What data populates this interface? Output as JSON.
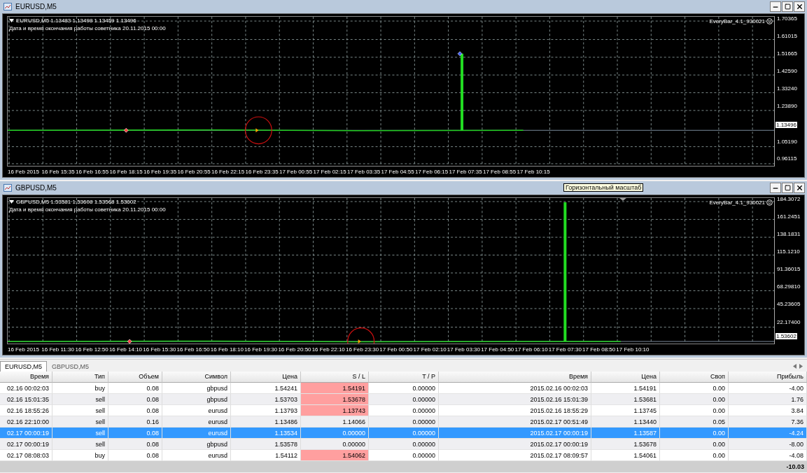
{
  "charts": [
    {
      "window_title": "EURUSD,M5",
      "info": "EURUSD,M5  1.13483 1.13498 1.13459 1.13496",
      "expert_note": "Дата и время окончания работы советника 20.11.2015 00:00",
      "expert_name": "EveryBar_4.1_930021",
      "price_labels": [
        "1.70365",
        "1.61015",
        "1.51665",
        "1.42590",
        "1.33240",
        "1.23890",
        "1.05190",
        "0.96115"
      ],
      "current_price": "1.13496",
      "time_labels": [
        "16 Feb 2015",
        "16 Feb 15:35",
        "16 Feb 16:55",
        "16 Feb 18:15",
        "16 Feb 19:35",
        "16 Feb 20:55",
        "16 Feb 22:15",
        "16 Feb 23:35",
        "17 Feb 00:55",
        "17 Feb 02:15",
        "17 Feb 03:35",
        "17 Feb 04:55",
        "17 Feb 06:15",
        "17 Feb 07:35",
        "17 Feb 08:55",
        "17 Feb 10:15"
      ]
    },
    {
      "window_title": "GBPUSD,M5",
      "info": "GBPUSD,M5  1.53581 1.53608 1.53568 1.53602",
      "expert_note": "Дата и время окончания работы советника 20.11.2015 00:00",
      "expert_name": "EveryBar_4.1_930021",
      "price_labels": [
        "184.3072",
        "161.2451",
        "138.1831",
        "115.1210",
        "91.36015",
        "68.29810",
        "45.23605",
        "22.17400"
      ],
      "current_price": "1.53602",
      "time_labels": [
        "16 Feb 2015",
        "16 Feb 11:30",
        "16 Feb 12:50",
        "16 Feb 14:10",
        "16 Feb 15:30",
        "16 Feb 16:50",
        "16 Feb 18:10",
        "16 Feb 19:30",
        "16 Feb 20:50",
        "16 Feb 22:10",
        "16 Feb 23:30",
        "17 Feb 00:50",
        "17 Feb 02:10",
        "17 Feb 03:30",
        "17 Feb 04:50",
        "17 Feb 06:10",
        "17 Feb 07:30",
        "17 Feb 08:50",
        "17 Feb 10:10"
      ]
    }
  ],
  "tooltip": "Горизонтальный масштаб",
  "tabs": [
    {
      "label": "EURUSD,M5",
      "selected": true
    },
    {
      "label": "GBPUSD,M5",
      "selected": false
    }
  ],
  "table": {
    "columns": [
      "Время",
      "Тип",
      "Объем",
      "Символ",
      "Цена",
      "S / L",
      "T / P",
      "Время",
      "Цена",
      "Своп",
      "Прибыль"
    ],
    "rows": [
      {
        "cells": [
          "02.16 00:02:03",
          "buy",
          "0.08",
          "gbpusd",
          "1.54241",
          "1.54191",
          "0.00000",
          "2015.02.16 00:02:03",
          "1.54191",
          "0.00",
          "-4.00"
        ],
        "selected": false,
        "sl_highlight": true
      },
      {
        "cells": [
          "02.16 15:01:35",
          "sell",
          "0.08",
          "gbpusd",
          "1.53703",
          "1.53678",
          "0.00000",
          "2015.02.16 15:01:39",
          "1.53681",
          "0.00",
          "1.76"
        ],
        "selected": false,
        "sl_highlight": true
      },
      {
        "cells": [
          "02.16 18:55:26",
          "sell",
          "0.08",
          "eurusd",
          "1.13793",
          "1.13743",
          "0.00000",
          "2015.02.16 18:55:29",
          "1.13745",
          "0.00",
          "3.84"
        ],
        "selected": false,
        "sl_highlight": true
      },
      {
        "cells": [
          "02.16 22:10:00",
          "sell",
          "0.16",
          "eurusd",
          "1.13486",
          "1.14066",
          "0.00000",
          "2015.02.17 00:51:49",
          "1.13440",
          "0.05",
          "7.36"
        ],
        "selected": false,
        "sl_highlight": false
      },
      {
        "cells": [
          "02.17 00:00:19",
          "sell",
          "0.08",
          "eurusd",
          "1.13534",
          "0.00000",
          "0.00000",
          "2015.02.17 00:00:19",
          "1.13587",
          "0.00",
          "-4.24"
        ],
        "selected": true,
        "sl_highlight": false
      },
      {
        "cells": [
          "02.17 00:00:19",
          "sell",
          "0.08",
          "gbpusd",
          "1.53578",
          "0.00000",
          "0.00000",
          "2015.02.17 00:00:19",
          "1.53678",
          "0.00",
          "-8.00"
        ],
        "selected": false,
        "sl_highlight": false
      },
      {
        "cells": [
          "02.17 08:08:03",
          "buy",
          "0.08",
          "eurusd",
          "1.54112",
          "1.54062",
          "0.00000",
          "2015.02.17 08:09:57",
          "1.54061",
          "0.00",
          "-4.08"
        ],
        "selected": false,
        "sl_highlight": true
      }
    ],
    "total": "-10.03"
  }
}
